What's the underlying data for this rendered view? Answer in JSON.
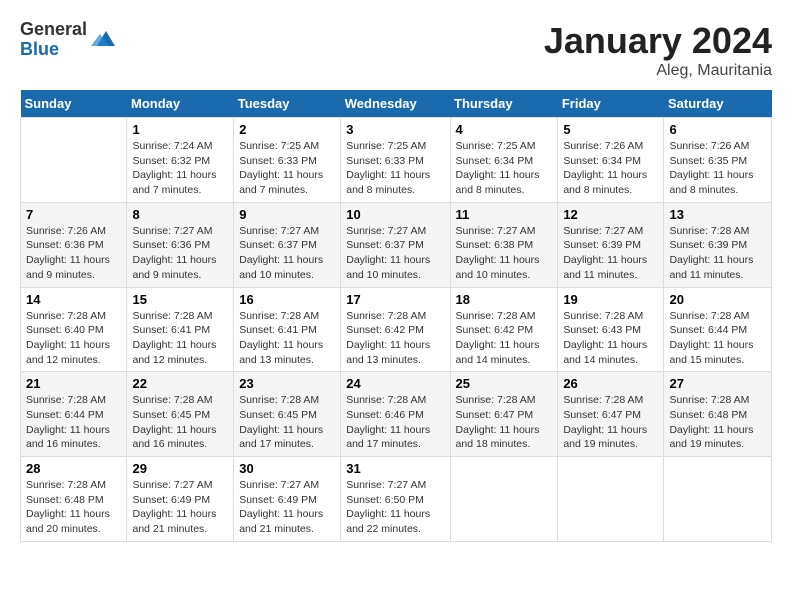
{
  "logo": {
    "general": "General",
    "blue": "Blue"
  },
  "title": {
    "month": "January 2024",
    "location": "Aleg, Mauritania"
  },
  "days_header": [
    "Sunday",
    "Monday",
    "Tuesday",
    "Wednesday",
    "Thursday",
    "Friday",
    "Saturday"
  ],
  "weeks": [
    [
      {
        "num": "",
        "info": ""
      },
      {
        "num": "1",
        "info": "Sunrise: 7:24 AM\nSunset: 6:32 PM\nDaylight: 11 hours\nand 7 minutes."
      },
      {
        "num": "2",
        "info": "Sunrise: 7:25 AM\nSunset: 6:33 PM\nDaylight: 11 hours\nand 7 minutes."
      },
      {
        "num": "3",
        "info": "Sunrise: 7:25 AM\nSunset: 6:33 PM\nDaylight: 11 hours\nand 8 minutes."
      },
      {
        "num": "4",
        "info": "Sunrise: 7:25 AM\nSunset: 6:34 PM\nDaylight: 11 hours\nand 8 minutes."
      },
      {
        "num": "5",
        "info": "Sunrise: 7:26 AM\nSunset: 6:34 PM\nDaylight: 11 hours\nand 8 minutes."
      },
      {
        "num": "6",
        "info": "Sunrise: 7:26 AM\nSunset: 6:35 PM\nDaylight: 11 hours\nand 8 minutes."
      }
    ],
    [
      {
        "num": "7",
        "info": "Sunrise: 7:26 AM\nSunset: 6:36 PM\nDaylight: 11 hours\nand 9 minutes."
      },
      {
        "num": "8",
        "info": "Sunrise: 7:27 AM\nSunset: 6:36 PM\nDaylight: 11 hours\nand 9 minutes."
      },
      {
        "num": "9",
        "info": "Sunrise: 7:27 AM\nSunset: 6:37 PM\nDaylight: 11 hours\nand 10 minutes."
      },
      {
        "num": "10",
        "info": "Sunrise: 7:27 AM\nSunset: 6:37 PM\nDaylight: 11 hours\nand 10 minutes."
      },
      {
        "num": "11",
        "info": "Sunrise: 7:27 AM\nSunset: 6:38 PM\nDaylight: 11 hours\nand 10 minutes."
      },
      {
        "num": "12",
        "info": "Sunrise: 7:27 AM\nSunset: 6:39 PM\nDaylight: 11 hours\nand 11 minutes."
      },
      {
        "num": "13",
        "info": "Sunrise: 7:28 AM\nSunset: 6:39 PM\nDaylight: 11 hours\nand 11 minutes."
      }
    ],
    [
      {
        "num": "14",
        "info": "Sunrise: 7:28 AM\nSunset: 6:40 PM\nDaylight: 11 hours\nand 12 minutes."
      },
      {
        "num": "15",
        "info": "Sunrise: 7:28 AM\nSunset: 6:41 PM\nDaylight: 11 hours\nand 12 minutes."
      },
      {
        "num": "16",
        "info": "Sunrise: 7:28 AM\nSunset: 6:41 PM\nDaylight: 11 hours\nand 13 minutes."
      },
      {
        "num": "17",
        "info": "Sunrise: 7:28 AM\nSunset: 6:42 PM\nDaylight: 11 hours\nand 13 minutes."
      },
      {
        "num": "18",
        "info": "Sunrise: 7:28 AM\nSunset: 6:42 PM\nDaylight: 11 hours\nand 14 minutes."
      },
      {
        "num": "19",
        "info": "Sunrise: 7:28 AM\nSunset: 6:43 PM\nDaylight: 11 hours\nand 14 minutes."
      },
      {
        "num": "20",
        "info": "Sunrise: 7:28 AM\nSunset: 6:44 PM\nDaylight: 11 hours\nand 15 minutes."
      }
    ],
    [
      {
        "num": "21",
        "info": "Sunrise: 7:28 AM\nSunset: 6:44 PM\nDaylight: 11 hours\nand 16 minutes."
      },
      {
        "num": "22",
        "info": "Sunrise: 7:28 AM\nSunset: 6:45 PM\nDaylight: 11 hours\nand 16 minutes."
      },
      {
        "num": "23",
        "info": "Sunrise: 7:28 AM\nSunset: 6:45 PM\nDaylight: 11 hours\nand 17 minutes."
      },
      {
        "num": "24",
        "info": "Sunrise: 7:28 AM\nSunset: 6:46 PM\nDaylight: 11 hours\nand 17 minutes."
      },
      {
        "num": "25",
        "info": "Sunrise: 7:28 AM\nSunset: 6:47 PM\nDaylight: 11 hours\nand 18 minutes."
      },
      {
        "num": "26",
        "info": "Sunrise: 7:28 AM\nSunset: 6:47 PM\nDaylight: 11 hours\nand 19 minutes."
      },
      {
        "num": "27",
        "info": "Sunrise: 7:28 AM\nSunset: 6:48 PM\nDaylight: 11 hours\nand 19 minutes."
      }
    ],
    [
      {
        "num": "28",
        "info": "Sunrise: 7:28 AM\nSunset: 6:48 PM\nDaylight: 11 hours\nand 20 minutes."
      },
      {
        "num": "29",
        "info": "Sunrise: 7:27 AM\nSunset: 6:49 PM\nDaylight: 11 hours\nand 21 minutes."
      },
      {
        "num": "30",
        "info": "Sunrise: 7:27 AM\nSunset: 6:49 PM\nDaylight: 11 hours\nand 21 minutes."
      },
      {
        "num": "31",
        "info": "Sunrise: 7:27 AM\nSunset: 6:50 PM\nDaylight: 11 hours\nand 22 minutes."
      },
      {
        "num": "",
        "info": ""
      },
      {
        "num": "",
        "info": ""
      },
      {
        "num": "",
        "info": ""
      }
    ]
  ]
}
